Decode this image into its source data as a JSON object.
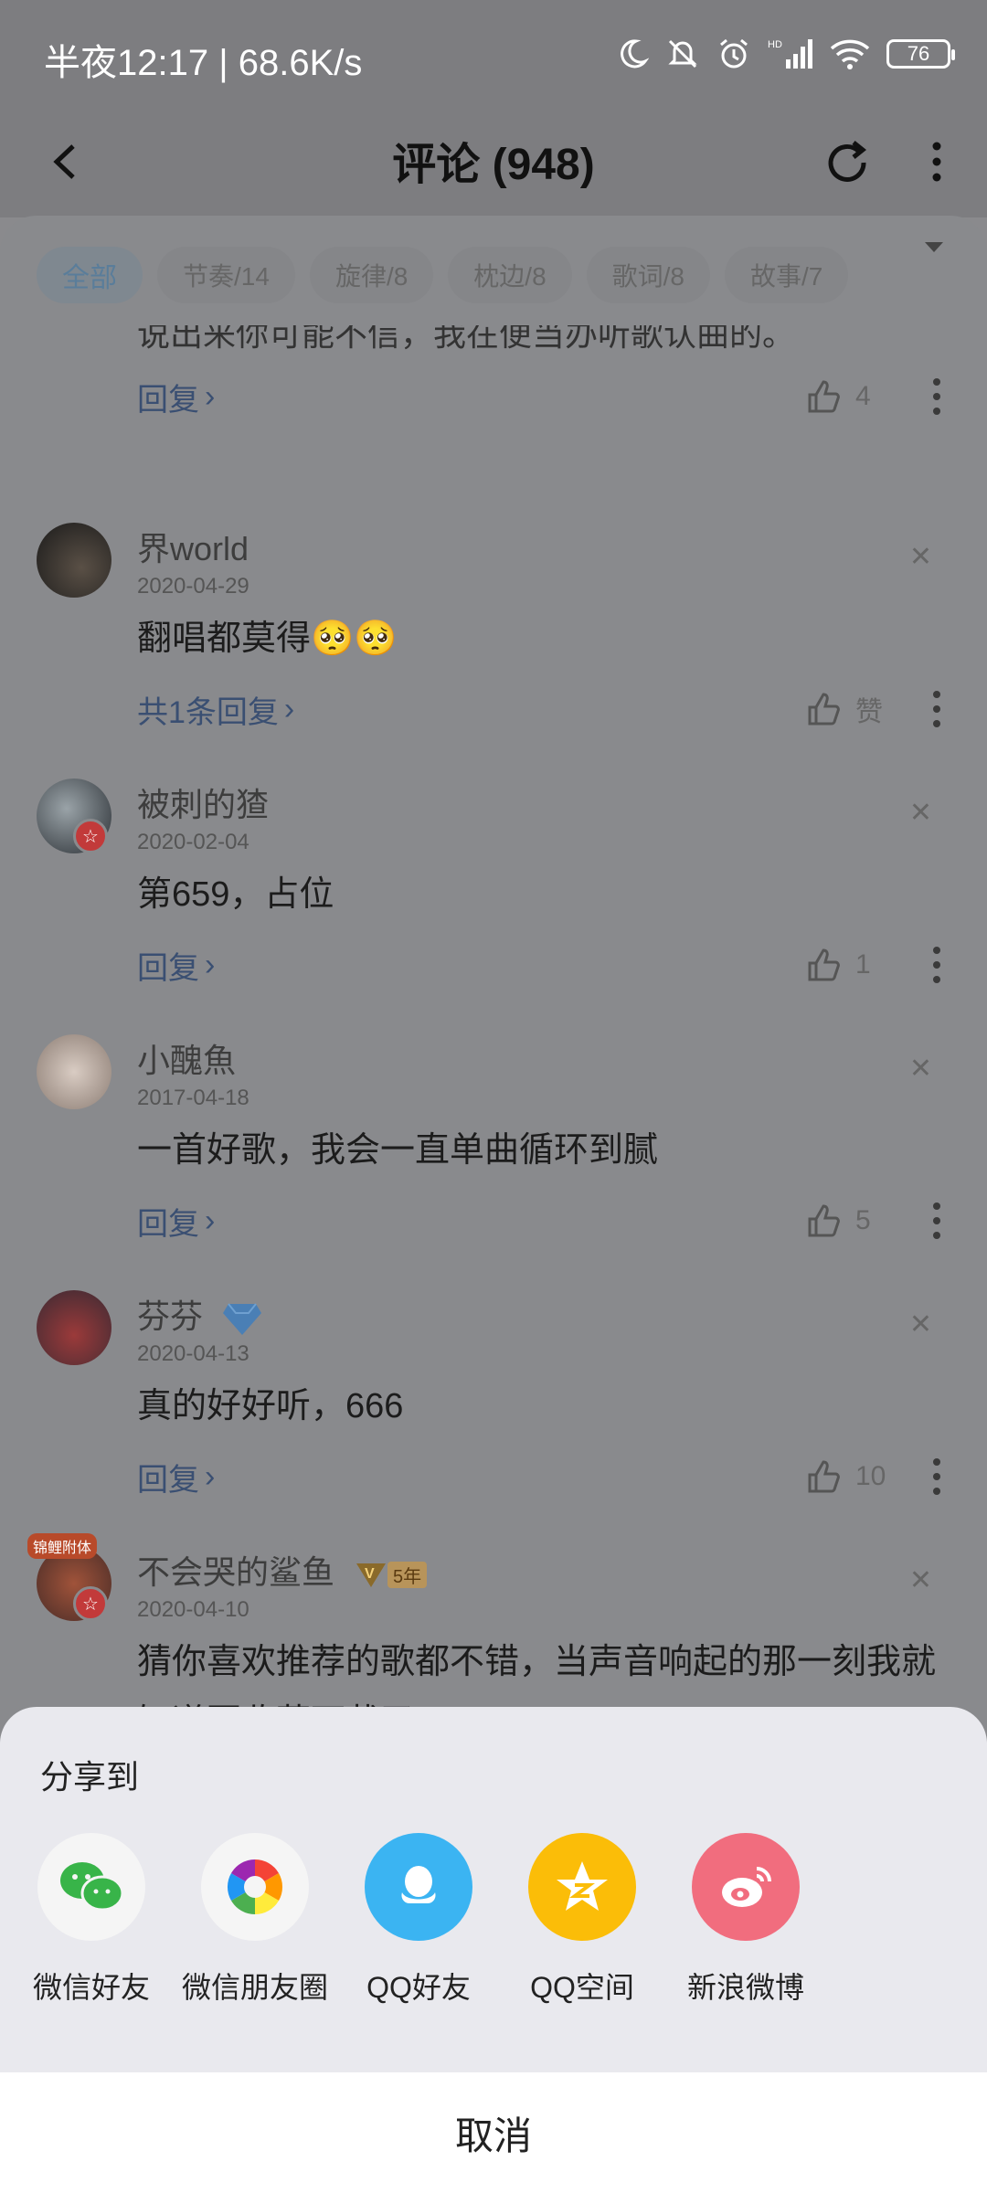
{
  "status_bar": {
    "time_speed": "半夜12:17 | 68.6K/s",
    "battery": "76"
  },
  "header": {
    "title": "评论 (948)"
  },
  "filters": [
    {
      "label": "全部"
    },
    {
      "label": "节奏/14"
    },
    {
      "label": "旋律/8"
    },
    {
      "label": "枕边/8"
    },
    {
      "label": "歌词/8"
    },
    {
      "label": "故事/7"
    }
  ],
  "partial_comment": {
    "text_clip": "说出来你可能不信，我在便当办听歌认曲的。",
    "reply": "回复",
    "likes": "4"
  },
  "comments": [
    {
      "name": "界world",
      "date": "2020-04-29",
      "text": "翻唱都莫得🥺🥺",
      "reply": "共1条回复",
      "likes": "赞"
    },
    {
      "name": "被刺的猹",
      "date": "2020-02-04",
      "text": "第659，占位",
      "reply": "回复",
      "likes": "1"
    },
    {
      "name": "小醜魚",
      "date": "2017-04-18",
      "text": "一首好歌，我会一直单曲循环到腻",
      "reply": "回复",
      "likes": "5"
    },
    {
      "name": "芬芬",
      "date": "2020-04-13",
      "text": "真的好好听，666",
      "reply": "回复",
      "likes": "10"
    },
    {
      "name": "不会哭的鲨鱼",
      "date": "2020-04-10",
      "text": "猜你喜欢推荐的歌都不错，当声音响起的那一刻我就知道要收藏下载了",
      "vip_badge": "5年",
      "avatar_badge": "锦鲤附体"
    }
  ],
  "share_sheet": {
    "title": "分享到",
    "items": [
      {
        "label": "微信好友",
        "icon": "wechat-icon",
        "color": "#f5f5f5"
      },
      {
        "label": "微信朋友圈",
        "icon": "moments-icon",
        "color": "#f5f5f5"
      },
      {
        "label": "QQ好友",
        "icon": "qq-icon",
        "color": "#3bb4f2"
      },
      {
        "label": "QQ空间",
        "icon": "qzone-icon",
        "color": "#fbbd08"
      },
      {
        "label": "新浪微博",
        "icon": "weibo-icon",
        "color": "#f16d7e"
      }
    ],
    "cancel": "取消"
  }
}
